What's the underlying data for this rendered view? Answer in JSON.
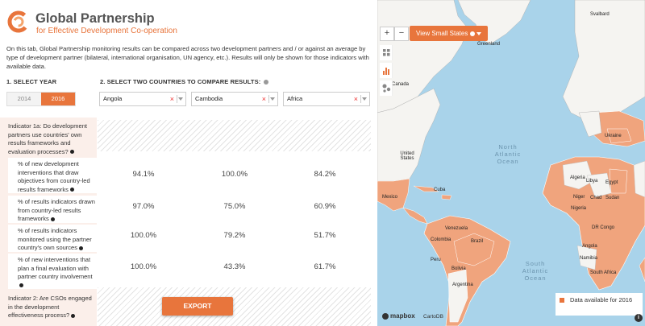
{
  "header": {
    "title": "Global Partnership",
    "subtitle": "for Effective Development Co-operation"
  },
  "intro": "On this tab, Global Partnership monitoring results can be compared across two development partners and / or against an average by type of development partner (bilateral, international organisation, UN agency, etc.). Results will only be shown for those indicators with available data.",
  "select_year": {
    "label": "1. SELECT YEAR",
    "years": [
      "2014",
      "2016"
    ],
    "selected": "2016"
  },
  "select_countries": {
    "label": "2. SELECT TWO COUNTRIES TO COMPARE RESULTS:",
    "values": [
      "Angola",
      "Cambodia",
      "Africa"
    ]
  },
  "indicator1": {
    "title": "Indicator 1a: Do development partners use countries' own results frameworks and evaluation processes?",
    "rows": [
      {
        "label": "% of new development interventions that draw objectives from country-led results frameworks",
        "values": [
          "94.1%",
          "100.0%",
          "84.2%"
        ]
      },
      {
        "label": "% of results indicators drawn from country-led results frameworks",
        "values": [
          "97.0%",
          "75.0%",
          "60.9%"
        ]
      },
      {
        "label": "% of results indicators monitored using the partner country's own sources",
        "values": [
          "100.0%",
          "79.2%",
          "51.7%"
        ]
      },
      {
        "label": "% of new interventions that plan a final evaluation with partner country involvement",
        "values": [
          "100.0%",
          "43.3%",
          "61.7%"
        ]
      }
    ]
  },
  "indicator2": {
    "title": "Indicator 2: Are CSOs engaged in the development effectiveness process?"
  },
  "export_label": "EXPORT",
  "map": {
    "zoom_in": "+",
    "zoom_out": "−",
    "small_states_label": "View Small States",
    "legend_label": "Data available for 2016",
    "accent_color": "#e8753c",
    "ocean_color": "#a9d3ea",
    "labels": {
      "svalbard": "Svalbard",
      "greenland": "Greenland",
      "canada": "Canada",
      "united_states": "United States",
      "mexico": "Mexico",
      "cuba": "Cuba",
      "brazil": "Brazil",
      "argentina": "Argentina",
      "ukraine": "Ukraine",
      "algeria": "Algeria",
      "libya": "Libya",
      "egypt": "Egypt",
      "niger": "Niger",
      "chad": "Chad",
      "sudan": "Sudan",
      "nigeria": "Nigeria",
      "dr_congo": "DR Congo",
      "angola": "Angola",
      "namibia": "Namibia",
      "south_africa": "South Africa",
      "peru": "Peru",
      "colombia": "Colombia",
      "venezuela": "Venezuela",
      "bolivia": "Bolivia"
    },
    "oceans": {
      "north_atlantic": "North\nAtlantic\nOcean",
      "south_atlantic": "South\nAtlantic\nOcean"
    },
    "attribution_mapbox": "mapbox",
    "attribution_carto": "CartoDB",
    "info": "i"
  }
}
